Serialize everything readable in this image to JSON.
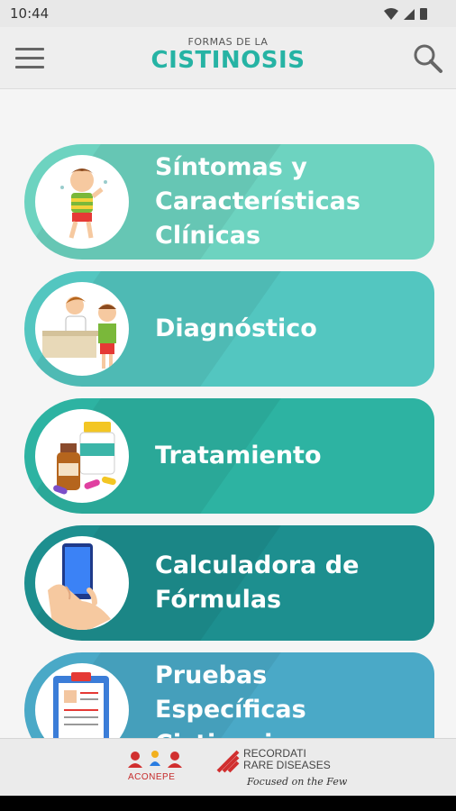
{
  "status_bar": {
    "time": "10:44"
  },
  "header": {
    "subtitle": "FORMAS DE LA",
    "title": "CISTINOSIS"
  },
  "menu": [
    {
      "label": "Síntomas y Características Clínicas",
      "icon": "child-sick-icon",
      "color": "#6dd3c0"
    },
    {
      "label": "Diagnóstico",
      "icon": "doctor-child-icon",
      "color": "#53c6c0"
    },
    {
      "label": "Tratamiento",
      "icon": "medicine-bottles-icon",
      "color": "#2db3a2"
    },
    {
      "label": "Calculadora de Fórmulas",
      "icon": "phone-hand-icon",
      "color": "#1d8f8f"
    },
    {
      "label": "Pruebas Específicas Cistinosis",
      "icon": "clipboard-icon",
      "color": "#4aa9c7"
    }
  ],
  "footer": {
    "logo1_text": "ACONEPE",
    "logo2_line1": "RECORDATI",
    "logo2_line2": "RARE DISEASES",
    "logo2_tagline": "Focused on the Few"
  }
}
